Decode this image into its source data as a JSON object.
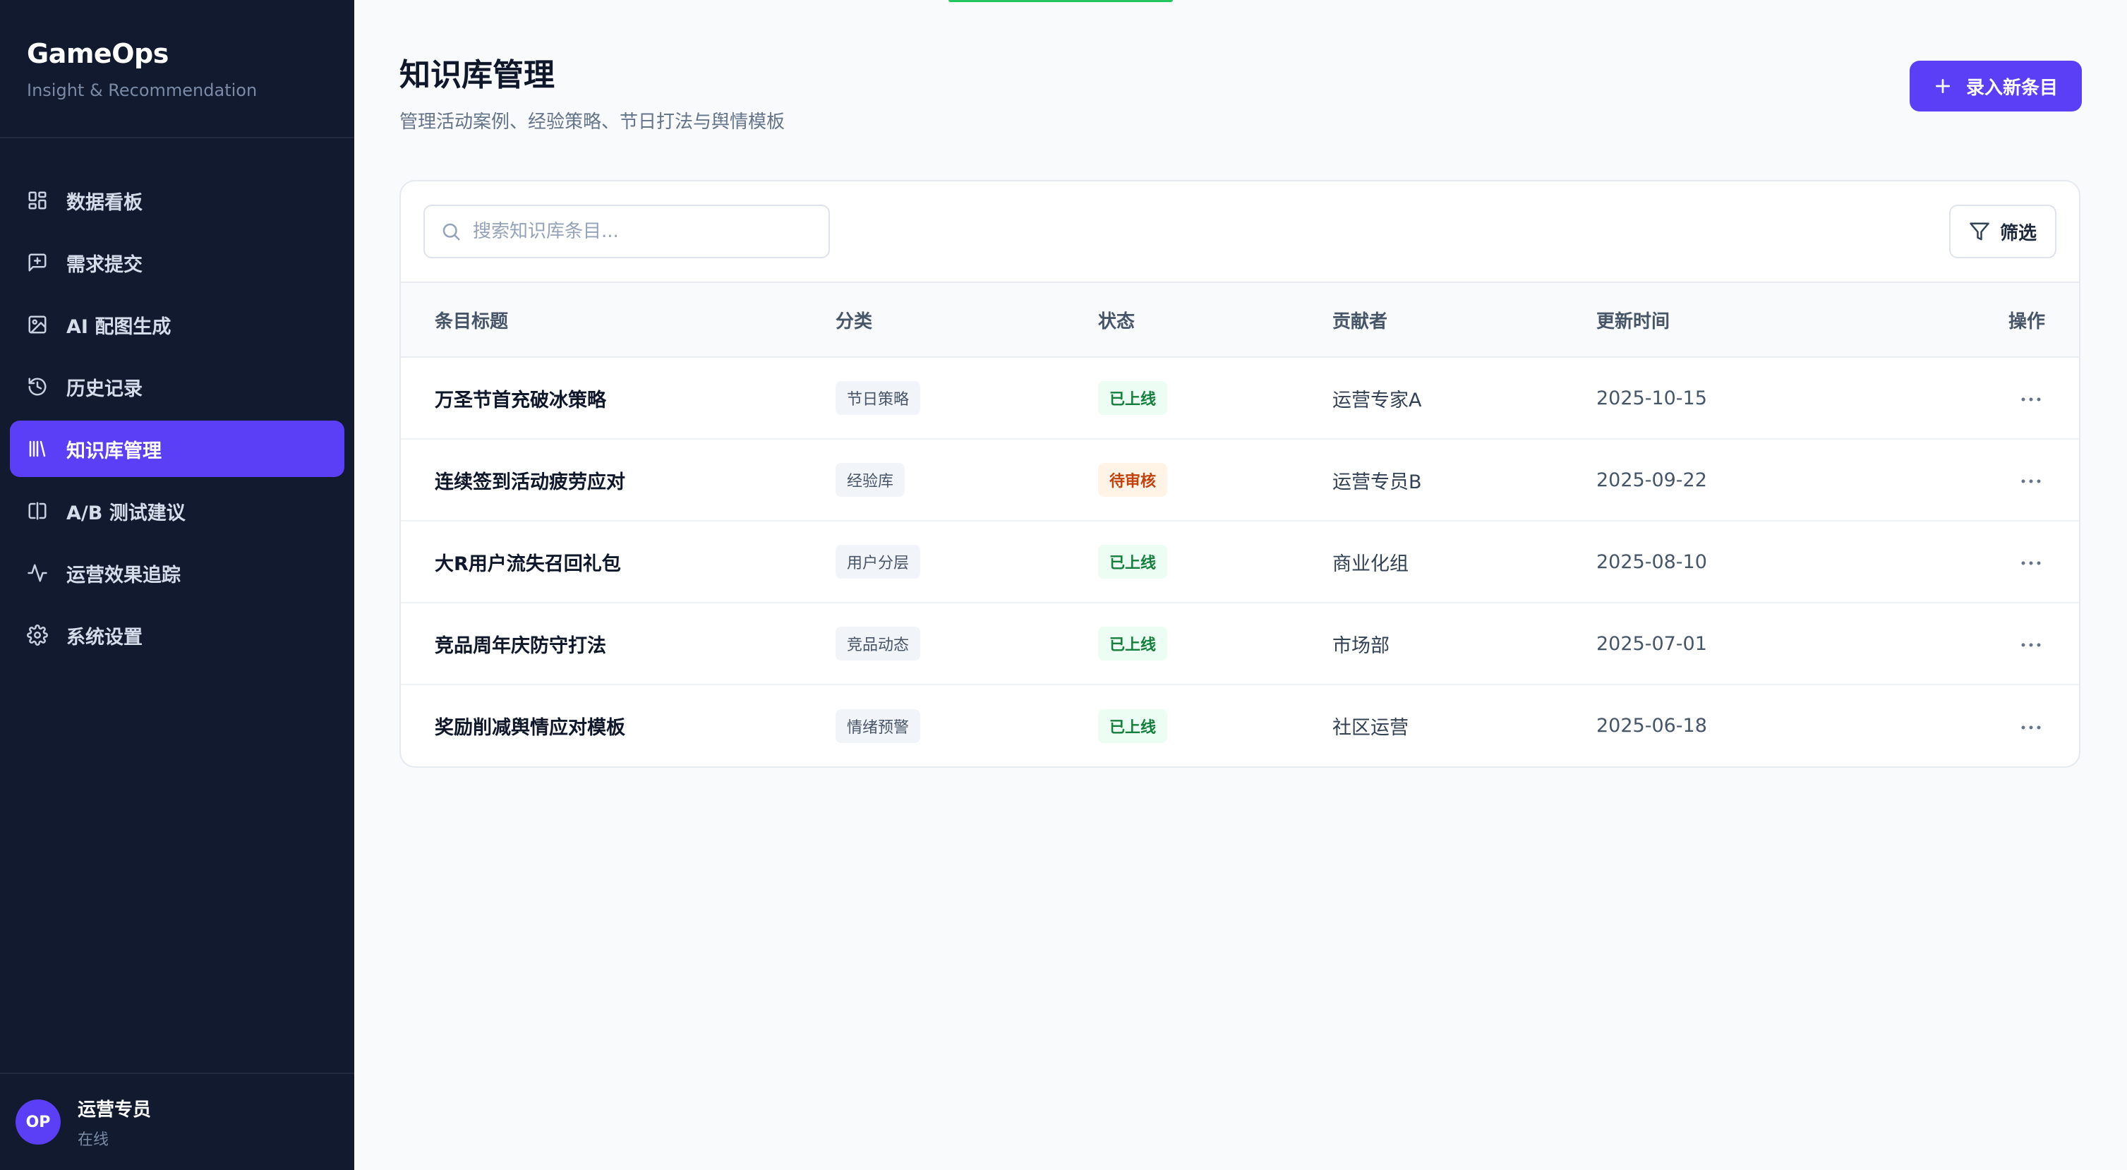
{
  "brand": {
    "name": "GameOps",
    "subtitle": "Insight & Recommendation"
  },
  "nav": [
    {
      "label": "数据看板",
      "icon": "dashboard-grid-icon",
      "active": false
    },
    {
      "label": "需求提交",
      "icon": "message-plus-icon",
      "active": false
    },
    {
      "label": "AI 配图生成",
      "icon": "image-icon",
      "active": false
    },
    {
      "label": "历史记录",
      "icon": "history-icon",
      "active": false
    },
    {
      "label": "知识库管理",
      "icon": "library-icon",
      "active": true
    },
    {
      "label": "A/B 测试建议",
      "icon": "split-compare-icon",
      "active": false
    },
    {
      "label": "运营效果追踪",
      "icon": "activity-icon",
      "active": false
    },
    {
      "label": "系统设置",
      "icon": "settings-gear-icon",
      "active": false
    }
  ],
  "user": {
    "initials": "OP",
    "name": "运营专员",
    "status": "在线"
  },
  "header": {
    "title": "知识库管理",
    "subtitle": "管理活动案例、经验策略、节日打法与舆情模板",
    "primary_action": "录入新条目"
  },
  "toolbar": {
    "search_placeholder": "搜索知识库条目...",
    "filter_label": "筛选"
  },
  "table": {
    "columns": [
      "条目标题",
      "分类",
      "状态",
      "贡献者",
      "更新时间",
      "操作"
    ],
    "rows": [
      {
        "title": "万圣节首充破冰策略",
        "category": "节日策略",
        "status": "已上线",
        "status_type": "ok",
        "contributor": "运营专家A",
        "updated": "2025-10-15"
      },
      {
        "title": "连续签到活动疲劳应对",
        "category": "经验库",
        "status": "待审核",
        "status_type": "pending",
        "contributor": "运营专员B",
        "updated": "2025-09-22"
      },
      {
        "title": "大R用户流失召回礼包",
        "category": "用户分层",
        "status": "已上线",
        "status_type": "ok",
        "contributor": "商业化组",
        "updated": "2025-08-10"
      },
      {
        "title": "竞品周年庆防守打法",
        "category": "竞品动态",
        "status": "已上线",
        "status_type": "ok",
        "contributor": "市场部",
        "updated": "2025-07-01"
      },
      {
        "title": "奖励削减舆情应对模板",
        "category": "情绪预警",
        "status": "已上线",
        "status_type": "ok",
        "contributor": "社区运营",
        "updated": "2025-06-18"
      }
    ]
  },
  "colors": {
    "accent": "#5b3ff6",
    "sidebar_bg": "#111a2e",
    "status_ok": "#15803d",
    "status_pending": "#c2410c"
  }
}
